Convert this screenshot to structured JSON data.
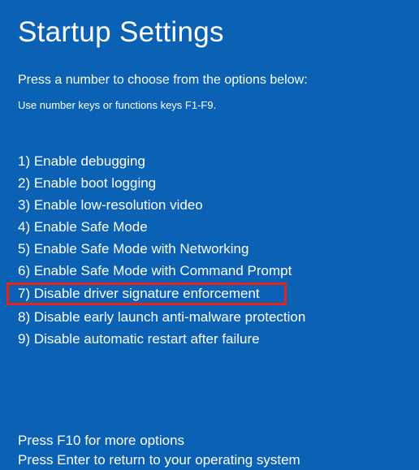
{
  "title": "Startup Settings",
  "subtitle": "Press a number to choose from the options below:",
  "hint": "Use number keys or functions keys F1-F9.",
  "options": [
    {
      "num": "1",
      "label": "Enable debugging",
      "highlighted": false
    },
    {
      "num": "2",
      "label": "Enable boot logging",
      "highlighted": false
    },
    {
      "num": "3",
      "label": "Enable low-resolution video",
      "highlighted": false
    },
    {
      "num": "4",
      "label": "Enable Safe Mode",
      "highlighted": false
    },
    {
      "num": "5",
      "label": "Enable Safe Mode with Networking",
      "highlighted": false
    },
    {
      "num": "6",
      "label": "Enable Safe Mode with Command Prompt",
      "highlighted": false
    },
    {
      "num": "7",
      "label": "Disable driver signature enforcement",
      "highlighted": true
    },
    {
      "num": "8",
      "label": "Disable early launch anti-malware protection",
      "highlighted": false
    },
    {
      "num": "9",
      "label": "Disable automatic restart after failure",
      "highlighted": false
    }
  ],
  "footer": {
    "more_options": "Press F10 for more options",
    "return_os": "Press Enter to return to your operating system"
  },
  "colors": {
    "background": "#0b61b3",
    "text": "#ffffff",
    "highlight_border": "#e6241a"
  }
}
